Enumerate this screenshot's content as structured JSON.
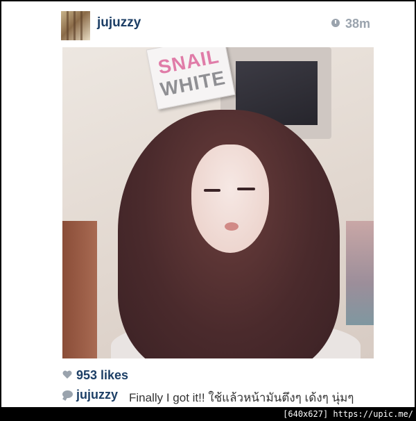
{
  "post": {
    "username": "jujuzzy",
    "time": "38m",
    "product_box": {
      "line1": "SNAIL",
      "line2": "WHITE"
    },
    "likes": "953 likes",
    "caption": {
      "username": "jujuzzy",
      "text": "Finally I got it!! ใช้แล้วหน้ามันตึงๆ เด้งๆ นุ่มๆ"
    }
  },
  "icons": {
    "time": "clock-icon",
    "likes": "heart-icon",
    "comments": "comment-bubble-icon"
  },
  "colors": {
    "username": "#1d3f66",
    "meta": "#9aa3ad",
    "box_pink": "#e07ca8"
  },
  "watermark": "[640x627] https://upic.me/"
}
